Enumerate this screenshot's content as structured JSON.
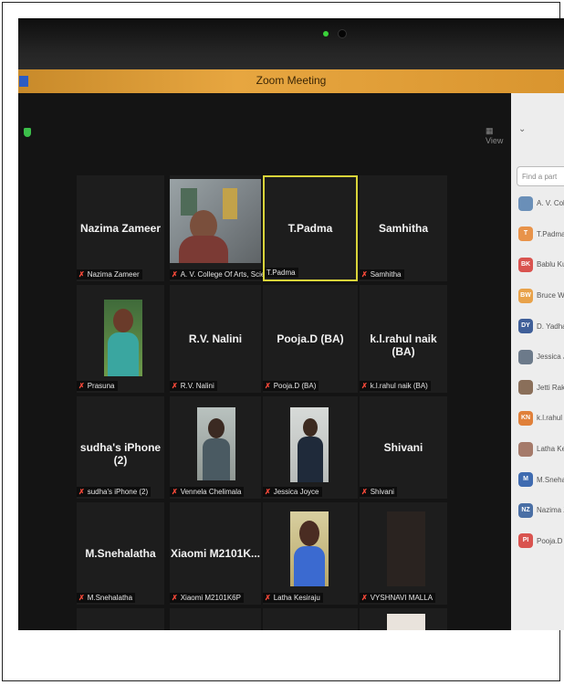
{
  "window": {
    "title": "Zoom Meeting",
    "view_label": "View"
  },
  "tiles": [
    {
      "big": "Nazima Zameer",
      "label": "Nazima Zameer"
    },
    {
      "big": "",
      "label": "A. V. College Of Arts, Scien..."
    },
    {
      "big": "T.Padma",
      "label": "T.Padma"
    },
    {
      "big": "Samhitha",
      "label": "Samhitha"
    },
    {
      "big": "",
      "label": "Prasuna"
    },
    {
      "big": "R.V. Nalini",
      "label": "R.V. Nalini"
    },
    {
      "big": "Pooja.D (BA)",
      "label": "Pooja.D (BA)"
    },
    {
      "big": "k.l.rahul naik (BA)",
      "label": "k.l.rahul naik (BA)"
    },
    {
      "big": "sudha's iPhone (2)",
      "label": "sudha's iPhone (2)"
    },
    {
      "big": "",
      "label": "Vennela Chelimala"
    },
    {
      "big": "",
      "label": "Jessica Joyce"
    },
    {
      "big": "Shivani",
      "label": "Shivani"
    },
    {
      "big": "M.Snehalatha",
      "label": "M.Snehalatha"
    },
    {
      "big": "Xiaomi M2101K...",
      "label": "Xiaomi M2101K6P"
    },
    {
      "big": "",
      "label": "Latha Kesiraju"
    },
    {
      "big": "",
      "label": "VYSHNAVI MALLA"
    }
  ],
  "participants_panel": {
    "search_placeholder": "Find a part",
    "items": [
      {
        "initials": "",
        "name": "A. V. Col",
        "color": "#6a8fb8"
      },
      {
        "initials": "T",
        "name": "T.Padma",
        "color": "#e8934a"
      },
      {
        "initials": "BK",
        "name": "Bablu Ku",
        "color": "#d9534f"
      },
      {
        "initials": "BW",
        "name": "Bruce W",
        "color": "#e8a24a"
      },
      {
        "initials": "DY",
        "name": "D. Yadha",
        "color": "#3f5f99"
      },
      {
        "initials": "",
        "name": "Jessica Jo",
        "color": "#6c7a8a"
      },
      {
        "initials": "",
        "name": "Jetti Rake",
        "color": "#8a6f5a"
      },
      {
        "initials": "KN",
        "name": "k.l.rahul n",
        "color": "#e0803a"
      },
      {
        "initials": "",
        "name": "Latha Kes",
        "color": "#a57a6a"
      },
      {
        "initials": "M",
        "name": "M.Snehal",
        "color": "#3f6bb0"
      },
      {
        "initials": "NZ",
        "name": "Nazima Z",
        "color": "#4a6fa5"
      },
      {
        "initials": "PI",
        "name": "Pooja.D (",
        "color": "#d9534f"
      }
    ]
  }
}
